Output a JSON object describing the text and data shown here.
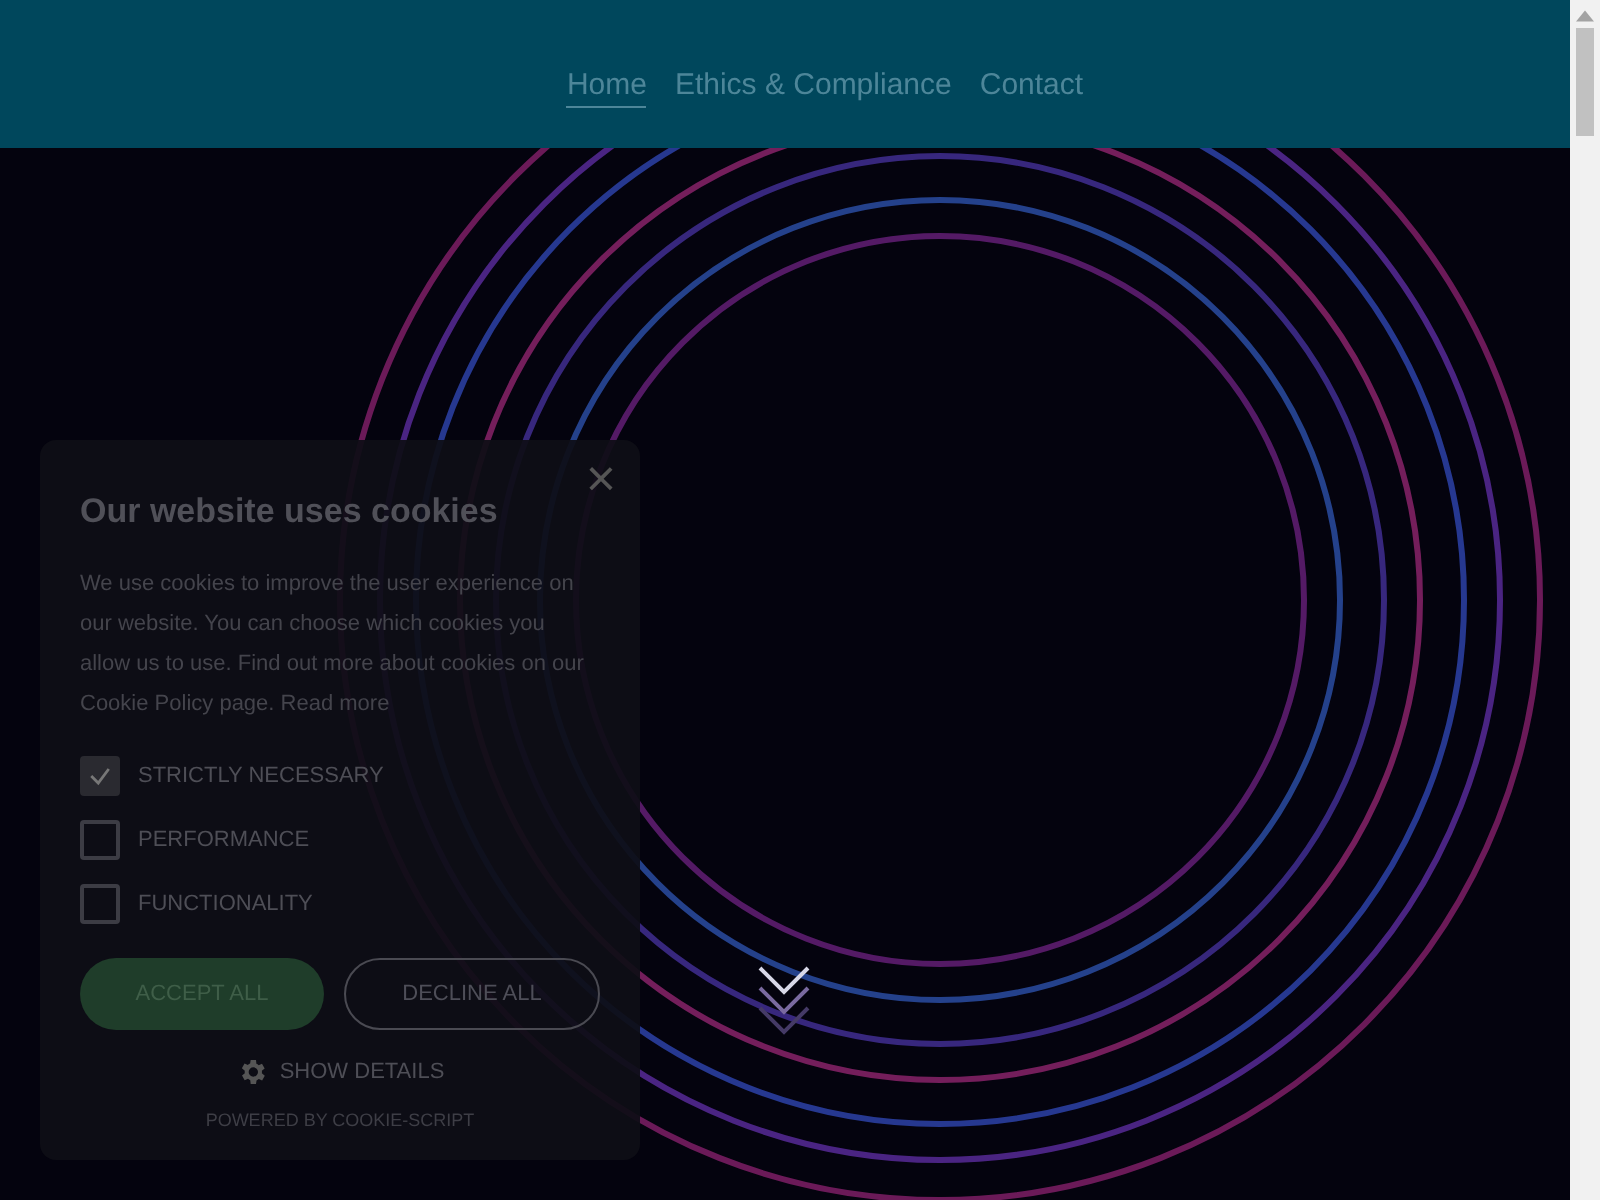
{
  "nav": {
    "items": [
      {
        "label": "Home",
        "selected": true
      },
      {
        "label": "Ethics & Compliance",
        "selected": false
      },
      {
        "label": "Contact",
        "selected": false
      }
    ]
  },
  "cookie_dialog": {
    "close": "×",
    "title": "Our website uses cookies",
    "text": "We use cookies to improve the user experience on our website. You can choose which cookies you allow us to use. Find out more about cookies on our Cookie Policy page.",
    "link": "Read more",
    "options": [
      {
        "label": "STRICTLY NECESSARY",
        "checked": true,
        "disabled": true
      },
      {
        "label": "PERFORMANCE",
        "checked": false,
        "disabled": false
      },
      {
        "label": "FUNCTIONALITY",
        "checked": false,
        "disabled": false
      }
    ],
    "accept": "ACCEPT ALL",
    "decline": "DECLINE ALL",
    "details": "SHOW DETAILS",
    "powered": "POWERED BY COOKIE-SCRIPT"
  }
}
